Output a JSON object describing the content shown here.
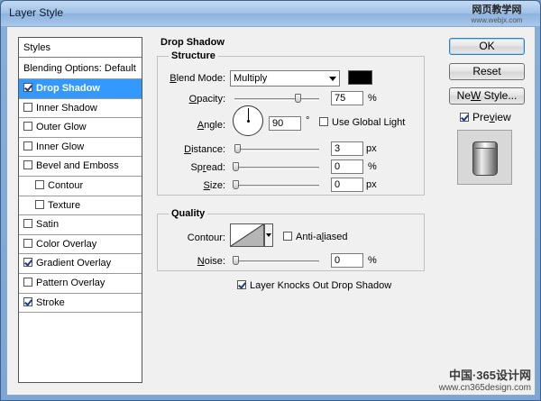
{
  "window": {
    "title": "Layer Style"
  },
  "watermark_top": {
    "line1": "网页教学网",
    "line2": "www.webjx.com"
  },
  "watermark_bottom": {
    "line1": "中国·365设计网",
    "line2": "www.cn365design.com"
  },
  "styles_panel": {
    "header": "Styles",
    "blending_options": "Blending Options: Default",
    "items": [
      {
        "label": "Drop Shadow",
        "checked": true,
        "selected": true
      },
      {
        "label": "Inner Shadow",
        "checked": false
      },
      {
        "label": "Outer Glow",
        "checked": false
      },
      {
        "label": "Inner Glow",
        "checked": false
      },
      {
        "label": "Bevel and Emboss",
        "checked": false
      },
      {
        "label": "Contour",
        "checked": false,
        "sub": true
      },
      {
        "label": "Texture",
        "checked": false,
        "sub": true
      },
      {
        "label": "Satin",
        "checked": false
      },
      {
        "label": "Color Overlay",
        "checked": false
      },
      {
        "label": "Gradient Overlay",
        "checked": true
      },
      {
        "label": "Pattern Overlay",
        "checked": false
      },
      {
        "label": "Stroke",
        "checked": true
      }
    ]
  },
  "drop_shadow": {
    "title": "Drop Shadow",
    "structure": {
      "title": "Structure",
      "blend_mode_label_u": "B",
      "blend_mode_label_rest": "lend Mode:",
      "blend_mode_value": "Multiply",
      "shadow_color": "#000000",
      "opacity_label_u": "O",
      "opacity_label_rest": "pacity:",
      "opacity_value": "75",
      "opacity_unit": "%",
      "opacity_fraction": 0.75,
      "angle_label_u": "A",
      "angle_label_rest": "ngle:",
      "angle_value": "90",
      "angle_unit": "°",
      "use_global_light_label": "Use Global Light",
      "use_global_light_checked": false,
      "distance_label_u": "D",
      "distance_label_rest": "istance:",
      "distance_value": "3",
      "distance_unit": "px",
      "spread_label_pre": "Sp",
      "spread_label_u": "r",
      "spread_label_rest": "ead:",
      "spread_value": "0",
      "spread_unit": "%",
      "size_label_u": "S",
      "size_label_rest": "ize:",
      "size_value": "0",
      "size_unit": "px"
    },
    "quality": {
      "title": "Quality",
      "contour_label": "Contour:",
      "anti_aliased_pre": "Anti-a",
      "anti_aliased_u": "l",
      "anti_aliased_rest": "iased",
      "anti_aliased_checked": false,
      "noise_label_u": "N",
      "noise_label_rest": "oise:",
      "noise_value": "0",
      "noise_unit": "%"
    },
    "knockout_label": "Layer Knocks Out Drop Shadow",
    "knockout_checked": true
  },
  "buttons": {
    "ok": "OK",
    "reset": "Reset",
    "new_style_u": "W",
    "new_style_pre": "Ne",
    "new_style_rest": " Style...",
    "preview_label_u": "v",
    "preview_label_pre": "Pre",
    "preview_label_rest": "iew",
    "preview_checked": true
  }
}
